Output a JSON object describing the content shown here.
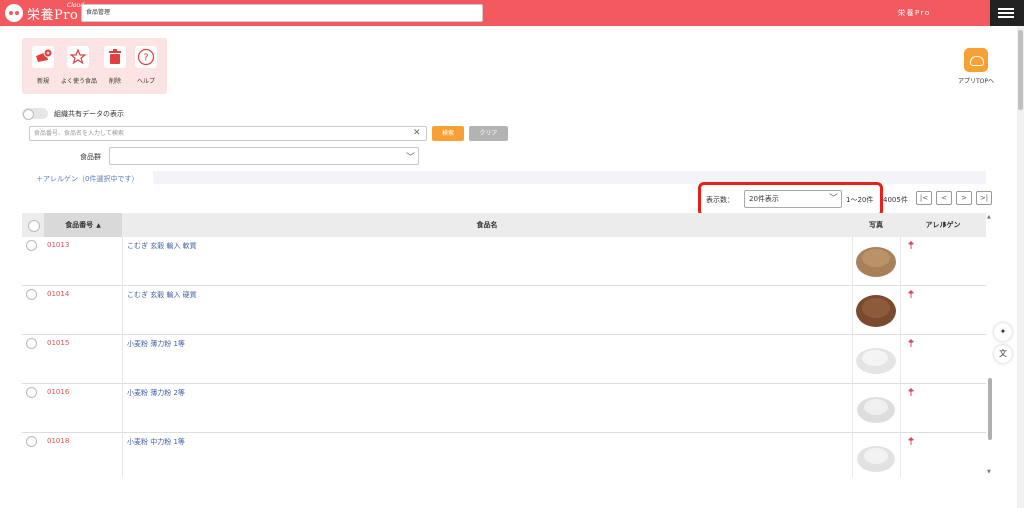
{
  "header": {
    "logo_text": "栄養Pro",
    "logo_cloud": "Cloud",
    "search_value": "食品管理",
    "user_name": "栄養Pro"
  },
  "toolbar": {
    "items": [
      {
        "label": "新規",
        "icon": "add-food-icon"
      },
      {
        "label": "よく使う食品",
        "icon": "star-icon"
      },
      {
        "label": "削除",
        "icon": "trash-icon"
      },
      {
        "label": "ヘルプ",
        "icon": "help-icon"
      }
    ],
    "app_top_label": "アプリTOPへ"
  },
  "filters": {
    "toggle_label": "組織共有データの表示",
    "search_placeholder": "食品番号、食品名を入力して検索",
    "search_button": "検索",
    "clear_button": "クリア",
    "group_label": "食品群",
    "group_value": "",
    "allergen_link": "＋アレルゲン（0件選択中です）"
  },
  "pager": {
    "display_label": "表示数：",
    "display_value": "20件表示",
    "range": "1～20件",
    "total": "4005件",
    "buttons": [
      "|<",
      "<",
      ">",
      ">|"
    ]
  },
  "table": {
    "columns": {
      "code": "食品番号",
      "name": "食品名",
      "photo": "写真",
      "allergy": "アレルゲン"
    },
    "rows": [
      {
        "code": "01013",
        "name": "こむぎ 玄穀 輸入 軟質",
        "photo_color": "#a8805a"
      },
      {
        "code": "01014",
        "name": "こむぎ 玄穀 輸入 硬質",
        "photo_color": "#8a5a3a"
      },
      {
        "code": "01015",
        "name": "小麦粉 薄力粉 1等",
        "photo_color": "#ececec"
      },
      {
        "code": "01016",
        "name": "小麦粉 薄力粉 2等",
        "photo_color": "#e6e6e6"
      },
      {
        "code": "01018",
        "name": "小麦粉 中力粉 1等",
        "photo_color": "#eaeaea"
      }
    ]
  },
  "colors": {
    "brand": "#f25a5f",
    "accent": "#f7a135",
    "highlight": "#e8201a"
  }
}
